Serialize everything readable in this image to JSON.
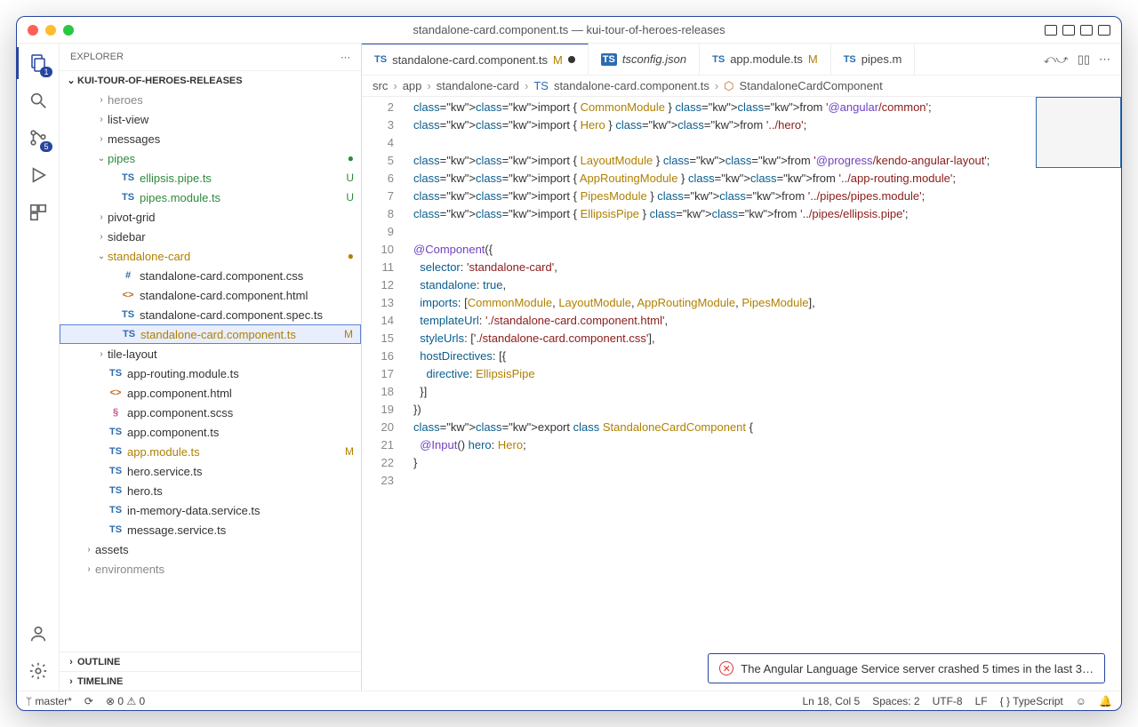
{
  "window": {
    "title": "standalone-card.component.ts — kui-tour-of-heroes-releases"
  },
  "sidebar": {
    "title": "EXPLORER",
    "root": "KUI-TOUR-OF-HEROES-RELEASES",
    "outline": "OUTLINE",
    "timeline": "TIMELINE",
    "tree": [
      {
        "kind": "folder",
        "name": "heroes",
        "open": false,
        "dim": true,
        "indent": 1
      },
      {
        "kind": "folder",
        "name": "list-view",
        "open": false,
        "indent": 1
      },
      {
        "kind": "folder",
        "name": "messages",
        "open": false,
        "indent": 1
      },
      {
        "kind": "folder",
        "name": "pipes",
        "open": true,
        "git": "dot-green",
        "indent": 1,
        "color": "git-new"
      },
      {
        "kind": "file",
        "name": "ellipsis.pipe.ts",
        "icon": "TS",
        "git": "U",
        "color": "git-new",
        "indent": 2
      },
      {
        "kind": "file",
        "name": "pipes.module.ts",
        "icon": "TS",
        "git": "U",
        "color": "git-new",
        "indent": 2
      },
      {
        "kind": "folder",
        "name": "pivot-grid",
        "open": false,
        "indent": 1
      },
      {
        "kind": "folder",
        "name": "sidebar",
        "open": false,
        "indent": 1
      },
      {
        "kind": "folder",
        "name": "standalone-card",
        "open": true,
        "git": "dot-yellow",
        "color": "git-mod",
        "indent": 1
      },
      {
        "kind": "file",
        "name": "standalone-card.component.css",
        "icon": "#",
        "iconcls": "css-icon",
        "indent": 2
      },
      {
        "kind": "file",
        "name": "standalone-card.component.html",
        "icon": "<>",
        "iconcls": "html-icon",
        "indent": 2
      },
      {
        "kind": "file",
        "name": "standalone-card.component.spec.ts",
        "icon": "TS",
        "indent": 2
      },
      {
        "kind": "file",
        "name": "standalone-card.component.ts",
        "icon": "TS",
        "git": "M",
        "color": "git-mod",
        "selected": true,
        "indent": 2
      },
      {
        "kind": "folder",
        "name": "tile-layout",
        "open": false,
        "indent": 1
      },
      {
        "kind": "file",
        "name": "app-routing.module.ts",
        "icon": "TS",
        "indent": 1
      },
      {
        "kind": "file",
        "name": "app.component.html",
        "icon": "<>",
        "iconcls": "html-icon",
        "indent": 1
      },
      {
        "kind": "file",
        "name": "app.component.scss",
        "icon": "§",
        "iconcls": "scss-icon",
        "indent": 1
      },
      {
        "kind": "file",
        "name": "app.component.ts",
        "icon": "TS",
        "indent": 1
      },
      {
        "kind": "file",
        "name": "app.module.ts",
        "icon": "TS",
        "git": "M",
        "color": "git-mod",
        "indent": 1
      },
      {
        "kind": "file",
        "name": "hero.service.ts",
        "icon": "TS",
        "indent": 1
      },
      {
        "kind": "file",
        "name": "hero.ts",
        "icon": "TS",
        "indent": 1
      },
      {
        "kind": "file",
        "name": "in-memory-data.service.ts",
        "icon": "TS",
        "indent": 1
      },
      {
        "kind": "file",
        "name": "message.service.ts",
        "icon": "TS",
        "indent": 1
      },
      {
        "kind": "folder",
        "name": "assets",
        "open": false,
        "indent": 0
      },
      {
        "kind": "folder",
        "name": "environments",
        "open": false,
        "dim": true,
        "indent": 0
      }
    ]
  },
  "tabs": [
    {
      "icon": "TS",
      "name": "standalone-card.component.ts",
      "mod": "M",
      "dirty": true,
      "active": true
    },
    {
      "icon": "TS",
      "iconbox": true,
      "name": "tsconfig.json",
      "italic": true
    },
    {
      "icon": "TS",
      "name": "app.module.ts",
      "mod": "M"
    },
    {
      "icon": "TS",
      "name": "pipes.m",
      "truncated": true
    }
  ],
  "breadcrumbs": {
    "parts": [
      "src",
      "app",
      "standalone-card"
    ],
    "file": "standalone-card.component.ts",
    "symbol": "StandaloneCardComponent"
  },
  "code": {
    "start": 2,
    "lines": [
      "import { CommonModule } from '@angular/common';",
      "import { Hero } from '../hero';",
      "",
      "import { LayoutModule } from '@progress/kendo-angular-layout';",
      "import { AppRoutingModule } from '../app-routing.module';",
      "import { PipesModule } from '../pipes/pipes.module';",
      "import { EllipsisPipe } from '../pipes/ellipsis.pipe';",
      "",
      "@Component({",
      "  selector: 'standalone-card',",
      "  standalone: true,",
      "  imports: [CommonModule, LayoutModule, AppRoutingModule, PipesModule],",
      "  templateUrl: './standalone-card.component.html',",
      "  styleUrls: ['./standalone-card.component.css'],",
      "  hostDirectives: [{",
      "    directive: EllipsisPipe",
      "  }]",
      "})",
      "export class StandaloneCardComponent {",
      "  @Input() hero: Hero;",
      "}",
      ""
    ]
  },
  "notification": "The Angular Language Service server crashed 5 times in the last 3…",
  "status": {
    "branch": "master*",
    "sync": "⟳",
    "problems": "⊗ 0 ⚠ 0",
    "cursor": "Ln 18, Col 5",
    "spaces": "Spaces: 2",
    "encoding": "UTF-8",
    "eol": "LF",
    "lang": "TypeScript"
  },
  "activity": {
    "explorer_badge": "1",
    "scm_badge": "5"
  }
}
